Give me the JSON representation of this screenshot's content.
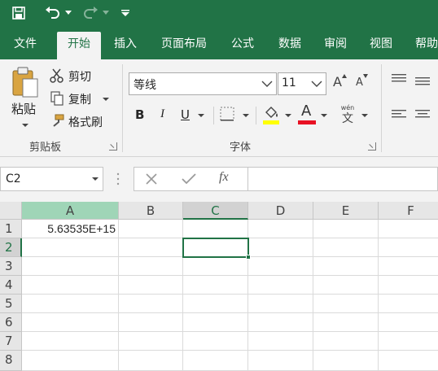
{
  "quick_access": {
    "save_icon": "save-icon",
    "undo_icon": "undo-icon",
    "redo_icon": "redo-icon",
    "customize_icon": "customize-qat-icon"
  },
  "tabs": [
    {
      "label": "文件",
      "active": false
    },
    {
      "label": "开始",
      "active": true
    },
    {
      "label": "插入",
      "active": false
    },
    {
      "label": "页面布局",
      "active": false
    },
    {
      "label": "公式",
      "active": false
    },
    {
      "label": "数据",
      "active": false
    },
    {
      "label": "审阅",
      "active": false
    },
    {
      "label": "视图",
      "active": false
    },
    {
      "label": "帮助",
      "active": false
    }
  ],
  "clipboard": {
    "paste_label": "粘贴",
    "cut_label": "剪切",
    "copy_label": "复制",
    "format_painter_label": "格式刷",
    "group_label": "剪贴板"
  },
  "font": {
    "font_name": "等线",
    "font_size": "11",
    "grow_label": "A",
    "shrink_label": "A",
    "bold_label": "B",
    "italic_label": "I",
    "underline_label": "U",
    "font_color_label": "A",
    "phonetic_top": "wén",
    "phonetic_bottom": "文",
    "group_label": "字体"
  },
  "colors": {
    "accent": "#217346",
    "highlight": "#ffff00",
    "font_color": "#e81123",
    "selected_col_A": "#9fd5b7"
  },
  "formula_bar": {
    "name_box": "C2",
    "cancel_icon": "cancel-icon",
    "enter_icon": "enter-icon",
    "fx_label": "fx",
    "formula": ""
  },
  "sheet": {
    "columns": [
      "A",
      "B",
      "C",
      "D",
      "E",
      "F"
    ],
    "rows": [
      "1",
      "2",
      "3",
      "4",
      "5",
      "6",
      "7",
      "8"
    ],
    "active_cell": "C2",
    "cells": {
      "A1": "5.63535E+15"
    }
  }
}
